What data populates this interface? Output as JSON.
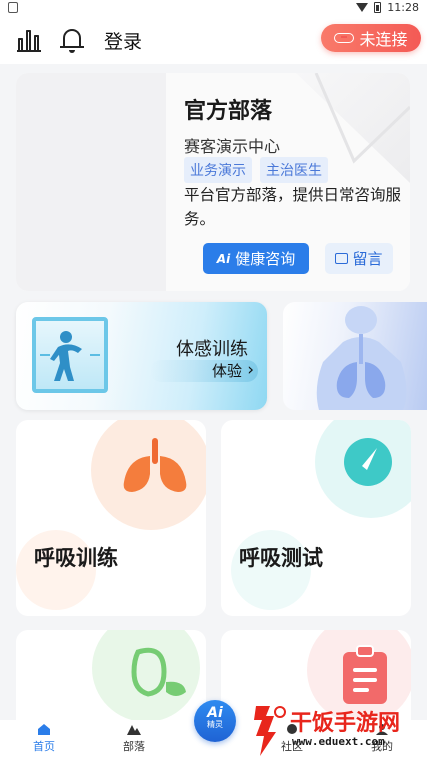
{
  "status_bar": {
    "time": "11:28"
  },
  "header": {
    "login_label": "登录",
    "connect_label": "未连接",
    "accent_color": "#f45a55"
  },
  "tribe_card": {
    "title": "官方部落",
    "subtitle": "赛客演示中心",
    "tags": [
      "业务演示",
      "主治医生"
    ],
    "description": "平台官方部落，提供日常咨询服务。",
    "consult_label": "健康咨询",
    "message_label": "留言",
    "accent_color": "#2b7de9"
  },
  "banner": {
    "title": "体感训练",
    "action_label": "体验"
  },
  "features": [
    {
      "title": "呼吸训练",
      "icon": "lungs-icon"
    },
    {
      "title": "呼吸测试",
      "icon": "compass-gauge-icon"
    },
    {
      "title": "",
      "icon": "leaf-icon"
    },
    {
      "title": "",
      "icon": "clipboard-icon"
    }
  ],
  "ai_button": {
    "label": "Ai",
    "sublabel": "精灵"
  },
  "bottom_nav": {
    "items": [
      {
        "label": "首页",
        "active": true
      },
      {
        "label": "部落",
        "active": false
      },
      {
        "label": "社区",
        "active": false
      },
      {
        "label": "我的",
        "active": false
      }
    ]
  },
  "watermark": {
    "name": "干饭手游网",
    "url": "www.eduext.com"
  }
}
